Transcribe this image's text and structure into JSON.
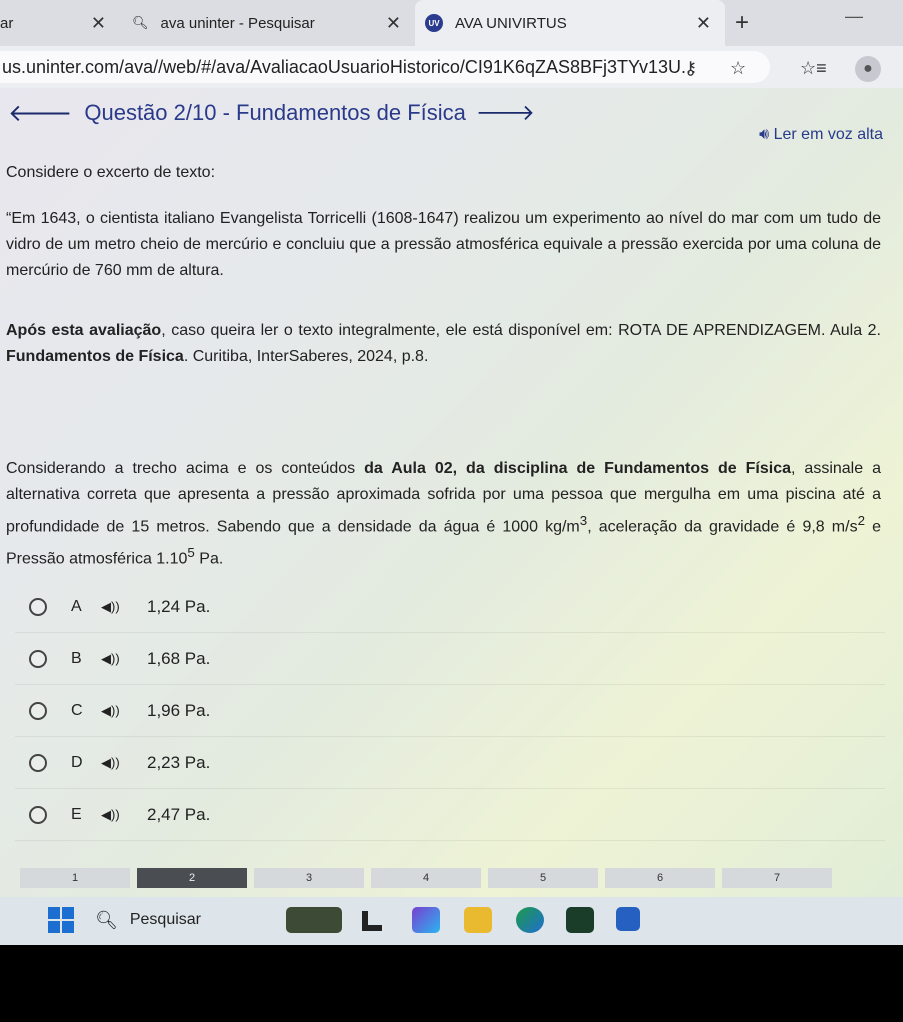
{
  "browser": {
    "tabs": [
      {
        "label": "ar"
      },
      {
        "label": "ava uninter - Pesquisar"
      },
      {
        "label": "AVA UNIVIRTUS"
      }
    ],
    "tab_favicon_text": "UV",
    "url": "us.uninter.com/ava//web/#/ava/AvaliacaoUsuarioHistorico/CI91K6qZAS8BFj3TYv13U..."
  },
  "page": {
    "question_title": "Questão 2/10 - Fundamentos de Física",
    "read_aloud": "Ler em voz alta",
    "intro": "Considere o excerto de texto:",
    "quote": "“Em 1643, o cientista italiano Evangelista Torricelli (1608-1647) realizou um experimento ao nível do mar com um tudo de vidro de um metro cheio de mercúrio e concluiu que a pressão atmosférica equivale a pressão exercida por uma coluna de mercúrio de 760 mm de altura.",
    "after_bold": "Após esta avaliação",
    "after_rest": ", caso queira ler o texto integralmente, ele está disponível em: ROTA DE APRENDIZAGEM. Aula 2. ",
    "after_bold2": "Fundamentos de Física",
    "after_end": ". Curitiba, InterSaberes, 2024, p.8.",
    "q_part1": "Considerando a trecho acima e os conteúdos ",
    "q_bold": "da Aula 02, da disciplina de Fundamentos de Física",
    "q_part2": ", assinale a alternativa correta que apresenta a pressão aproximada sofrida por uma pessoa que mergulha em uma piscina até a profundidade de 15  metros. Sabendo que a densidade da água é ",
    "q_density": "1000 kg/m",
    "q_density_exp": "3",
    "q_part3": ", aceleração da gravidade é ",
    "q_gravity": "9,8 m/s",
    "q_gravity_exp": "2",
    "q_part4": " e Pressão atmosférica ",
    "q_pressure": "1.10",
    "q_pressure_exp": "5",
    "q_pressure_unit": " Pa.",
    "options": [
      {
        "letter": "A",
        "text": "1,24 Pa."
      },
      {
        "letter": "B",
        "text": "1,68 Pa."
      },
      {
        "letter": "C",
        "text": "1,96 Pa."
      },
      {
        "letter": "D",
        "text": "2,23 Pa."
      },
      {
        "letter": "E",
        "text": "2,47 Pa."
      }
    ],
    "pagination": [
      "1",
      "2",
      "3",
      "4",
      "5",
      "6",
      "7"
    ],
    "active_page": 2
  },
  "taskbar": {
    "search_label": "Pesquisar"
  }
}
